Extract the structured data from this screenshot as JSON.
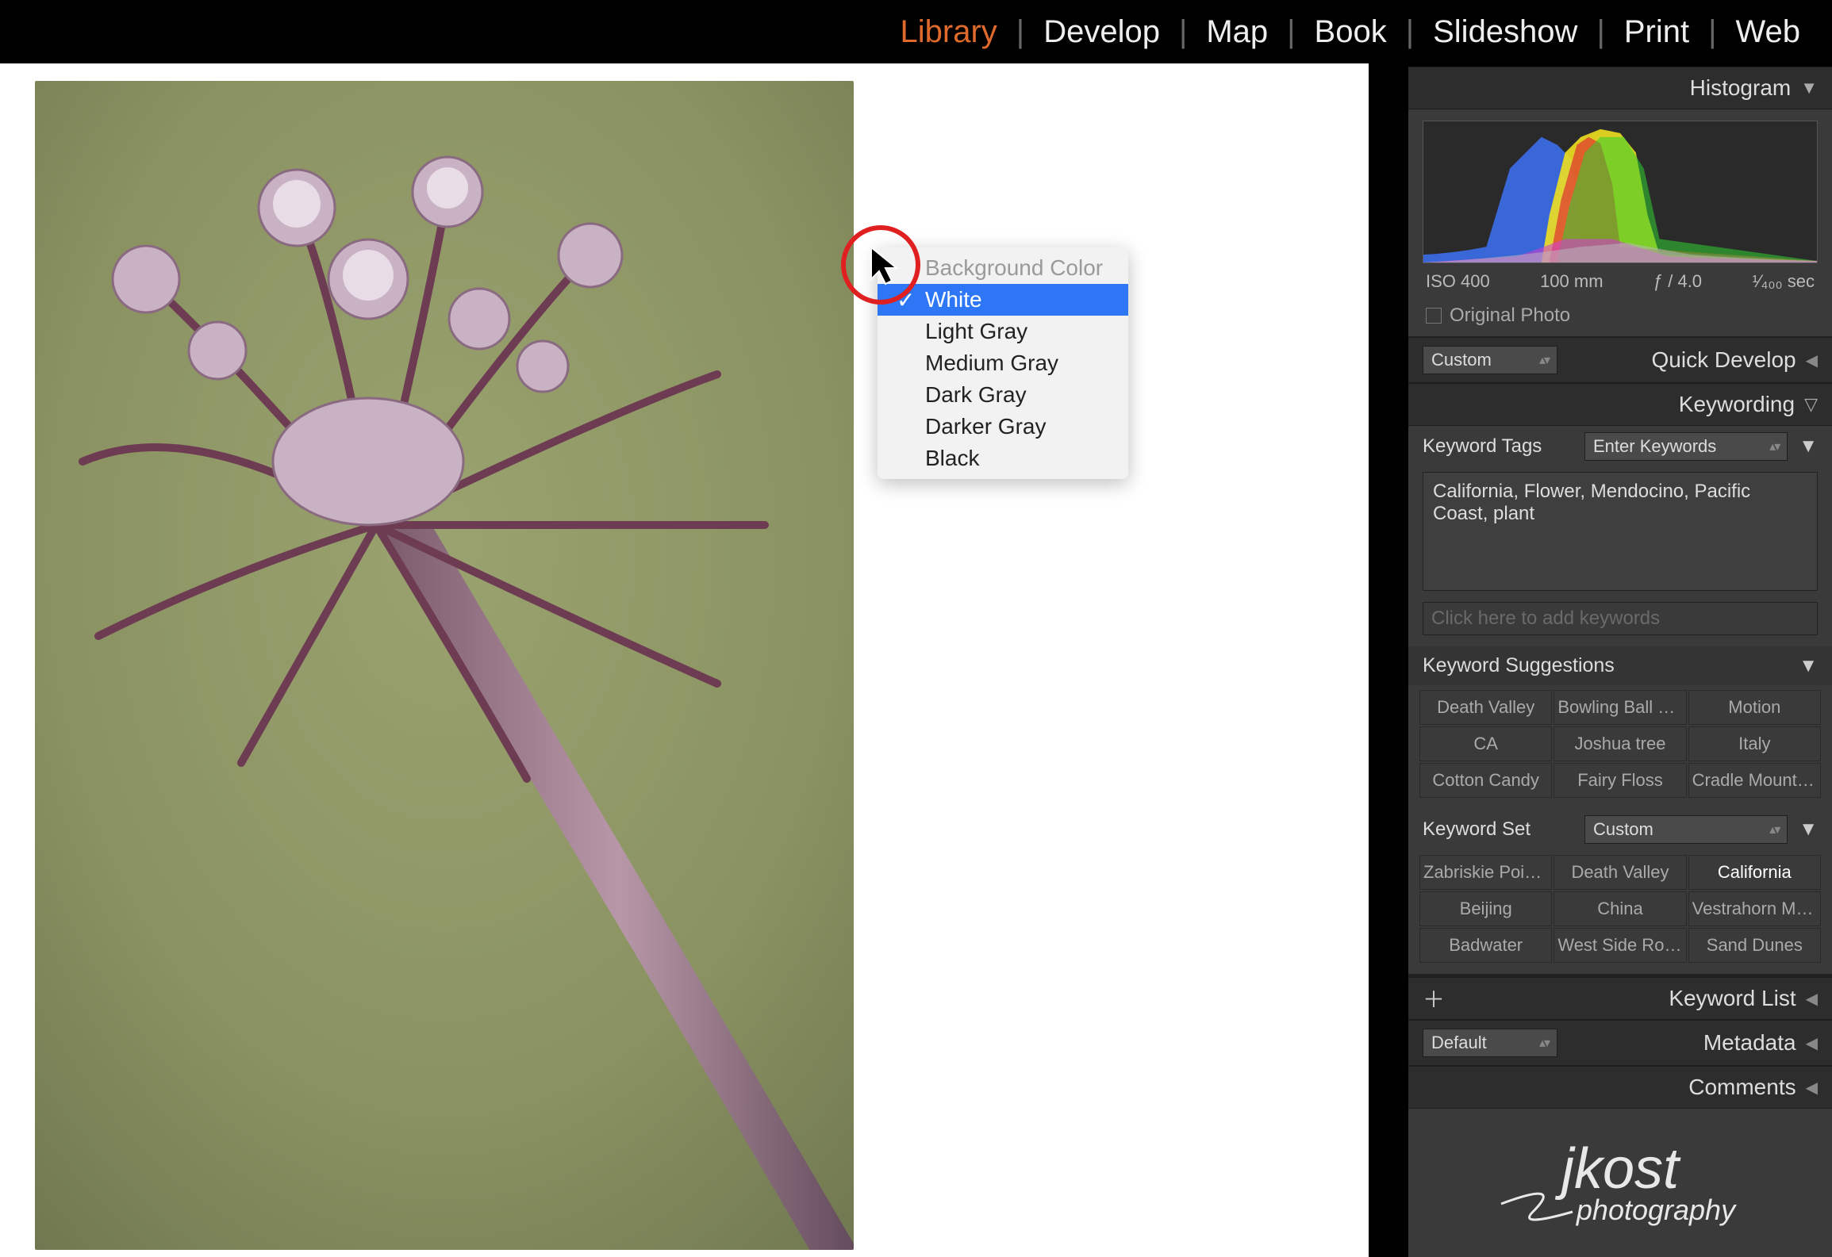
{
  "modules": {
    "library": "Library",
    "develop": "Develop",
    "map": "Map",
    "book": "Book",
    "slideshow": "Slideshow",
    "print": "Print",
    "web": "Web",
    "active": "library"
  },
  "context_menu": {
    "header": "Background Color",
    "items": [
      "White",
      "Light Gray",
      "Medium Gray",
      "Dark Gray",
      "Darker Gray",
      "Black"
    ],
    "selected": "White"
  },
  "histogram": {
    "title": "Histogram",
    "iso": "ISO 400",
    "focal": "100 mm",
    "aperture": "ƒ / 4.0",
    "shutter_html": "¹⁄₄₀₀ sec",
    "original_label": "Original Photo"
  },
  "quick_develop": {
    "title": "Quick Develop",
    "preset": "Custom"
  },
  "keywording": {
    "title": "Keywording",
    "tags_label": "Keyword Tags",
    "tags_mode": "Enter Keywords",
    "tags_value": "California, Flower, Mendocino, Pacific Coast, plant",
    "add_placeholder": "Click here to add keywords",
    "suggestions_label": "Keyword Suggestions",
    "suggestions": [
      "Death Valley",
      "Bowling Ball B…",
      "Motion",
      "CA",
      "Joshua tree",
      "Italy",
      "Cotton Candy",
      "Fairy Floss",
      "Cradle Mountain"
    ],
    "set_label": "Keyword Set",
    "set_value": "Custom",
    "set_items": [
      "Zabriskie Point…",
      "Death Valley",
      "California",
      "Beijing",
      "China",
      "Vestrahorn Mo…",
      "Badwater",
      "West Side Road",
      "Sand Dunes"
    ],
    "set_highlight": "California"
  },
  "keyword_list": {
    "title": "Keyword List"
  },
  "metadata": {
    "title": "Metadata",
    "preset": "Default"
  },
  "comments": {
    "title": "Comments"
  },
  "identity_plate": "jkost photography"
}
